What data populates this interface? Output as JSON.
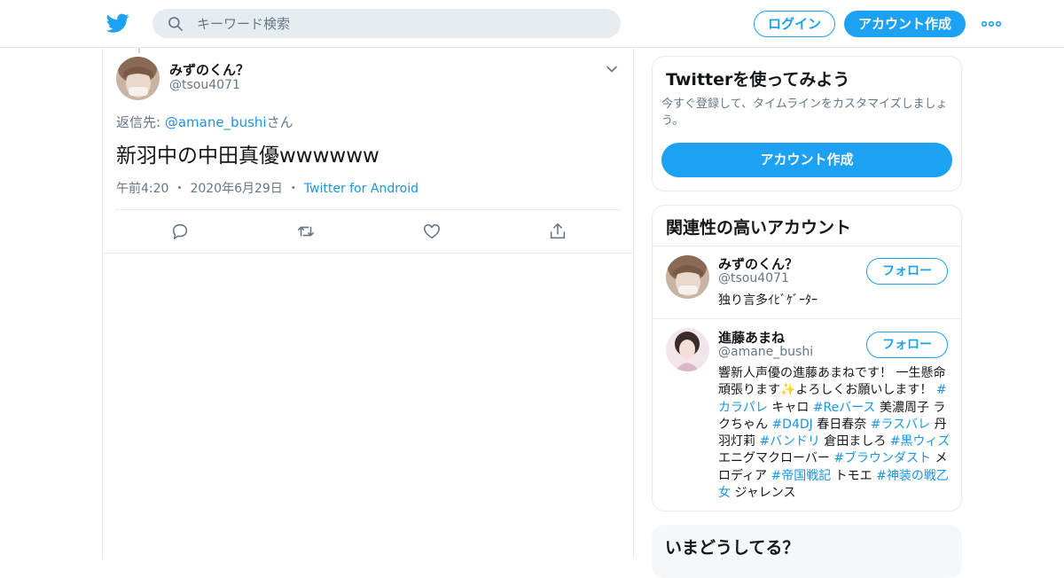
{
  "header": {
    "search_placeholder": "キーワード検索",
    "login_label": "ログイン",
    "signup_label": "アカウント作成",
    "brand_color": "#1da1f2"
  },
  "tweet": {
    "author_name": "みずのくん？",
    "author_handle": "@tsou4071",
    "reply_prefix": "返信先: ",
    "reply_handle": "@amane_bushi",
    "reply_suffix": "さん",
    "text": "新羽中の中田真優wwwwww",
    "time": "午前4:20",
    "date": "2020年6月29日",
    "source": "Twitter for Android",
    "separator": "・"
  },
  "sidebar": {
    "signup_card": {
      "title": "Twitterを使ってみよう",
      "description": "今すぐ登録して、タイムラインをカスタマイズしましょう。",
      "button_label": "アカウント作成"
    },
    "related": {
      "title": "関連性の高いアカウント",
      "accounts": [
        {
          "name": "みずのくん？",
          "handle": "@tsou4071",
          "follow_label": "フォロー",
          "bio": "独り言多ｲﾋﾞｹﾞｰﾀｰ"
        },
        {
          "name": "進藤あまね",
          "handle": "@amane_bushi",
          "follow_label": "フォロー",
          "bio_parts": [
            {
              "text": "響新人声優の進藤あまねです！ 一生懸命頑張ります",
              "tag": false
            },
            {
              "text": "✨",
              "tag": false
            },
            {
              "text": "よろしくお願いします！ ",
              "tag": false
            },
            {
              "text": "#カラパレ",
              "tag": true
            },
            {
              "text": " キャロ ",
              "tag": false
            },
            {
              "text": "#Reバース",
              "tag": true
            },
            {
              "text": " 美濃周子 ラクちゃん ",
              "tag": false
            },
            {
              "text": "#D4DJ",
              "tag": true
            },
            {
              "text": " 春日春奈 ",
              "tag": false
            },
            {
              "text": "#ラスバレ",
              "tag": true
            },
            {
              "text": " 丹羽灯莉 ",
              "tag": false
            },
            {
              "text": "#バンドリ",
              "tag": true
            },
            {
              "text": " 倉田ましろ ",
              "tag": false
            },
            {
              "text": "#黒ウィズ",
              "tag": true
            },
            {
              "text": " エニグマクローバー ",
              "tag": false
            },
            {
              "text": "#ブラウンダスト",
              "tag": true
            },
            {
              "text": " メロディア ",
              "tag": false
            },
            {
              "text": "#帝国戦記",
              "tag": true
            },
            {
              "text": " トモエ ",
              "tag": false
            },
            {
              "text": "#神装の戦乙女",
              "tag": true
            },
            {
              "text": " ジャレンス",
              "tag": false
            }
          ]
        }
      ]
    },
    "trends_card": {
      "title": "いまどうしてる？"
    }
  },
  "icons": [
    "twitter-bird-icon",
    "search-icon",
    "more-icon",
    "chevron-down-icon",
    "reply-icon",
    "retweet-icon",
    "like-icon",
    "share-icon"
  ]
}
